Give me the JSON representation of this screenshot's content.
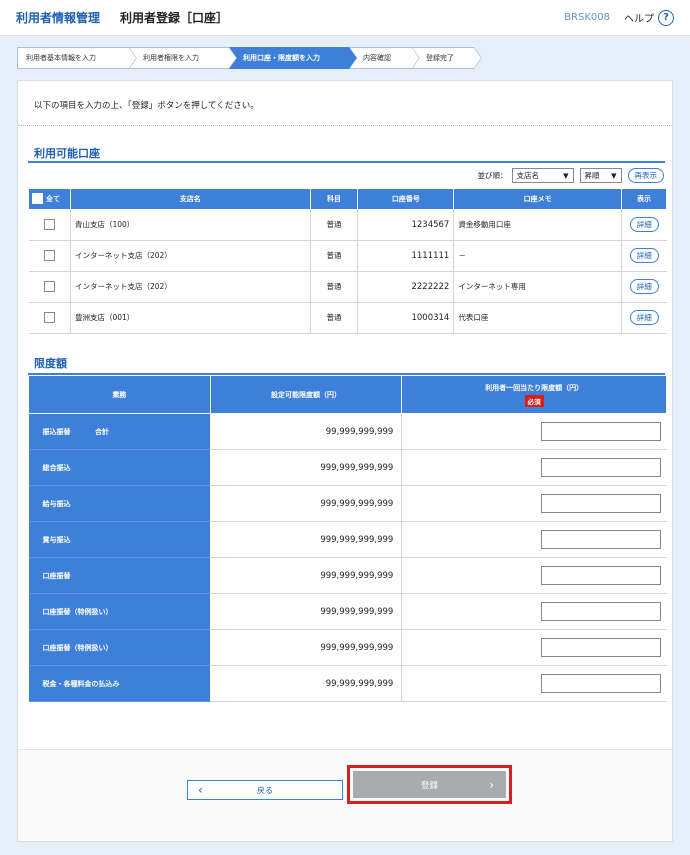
{
  "header": {
    "section": "利用者情報管理",
    "title": "利用者登録［口座］",
    "screen_code": "BRSK008",
    "help_label": "ヘルプ",
    "help_icon_glyph": "?"
  },
  "steps": [
    {
      "label": "利用者基本情報を入力",
      "active": false
    },
    {
      "label": "利用者権限を入力",
      "active": false
    },
    {
      "label": "利用口座・限度額を入力",
      "active": true
    },
    {
      "label": "内容確認",
      "active": false
    },
    {
      "label": "登録完了",
      "active": false
    }
  ],
  "instruction": "以下の項目を入力の上、「登録」ボタンを押してください。",
  "accounts_section": {
    "title": "利用可能口座",
    "sort_label": "並び順：",
    "sort_field": "支店名",
    "sort_order": "昇順",
    "redisplay_label": "再表示",
    "columns": {
      "all": "全て",
      "branch": "支店名",
      "type": "科目",
      "number": "口座番号",
      "memo": "口座メモ",
      "show": "表示"
    },
    "rows": [
      {
        "branch": "青山支店（100）",
        "type": "普通",
        "number": "1234567",
        "memo": "資金移動用口座",
        "detail": "詳細"
      },
      {
        "branch": "インターネット支店（202）",
        "type": "普通",
        "number": "1111111",
        "memo": "－",
        "detail": "詳細"
      },
      {
        "branch": "インターネット支店（202）",
        "type": "普通",
        "number": "2222222",
        "memo": "インターネット専用",
        "detail": "詳細"
      },
      {
        "branch": "豊洲支店（001）",
        "type": "普通",
        "number": "1000314",
        "memo": "代表口座",
        "detail": "詳細"
      }
    ]
  },
  "limits_section": {
    "title": "限度額",
    "columns": {
      "business": "業務",
      "configurable": "設定可能限度額（円）",
      "per_transaction": "利用者一回当たり限度額（円）",
      "required_badge": "必須"
    },
    "rows": [
      {
        "business": "振込振替",
        "sub": "合計",
        "amount": "99,999,999,999"
      },
      {
        "business": "総合振込",
        "sub": "",
        "amount": "999,999,999,999"
      },
      {
        "business": "給与振込",
        "sub": "",
        "amount": "999,999,999,999"
      },
      {
        "business": "賞与振込",
        "sub": "",
        "amount": "999,999,999,999"
      },
      {
        "business": "口座振替",
        "sub": "",
        "amount": "999,999,999,999"
      },
      {
        "business": "口座振替（特例扱い）",
        "sub": "",
        "amount": "999,999,999,999"
      },
      {
        "business": "口座振替（特例扱い）",
        "sub": "",
        "amount": "999,999,999,999"
      },
      {
        "business": "税金・各種料金の払込み",
        "sub": "",
        "amount": "99,999,999,999"
      }
    ]
  },
  "buttons": {
    "back": "戻る",
    "register": "登録"
  },
  "colors": {
    "accent": "#3d7fd9",
    "highlight": "#d7201b",
    "disabled": "#a9abae"
  }
}
